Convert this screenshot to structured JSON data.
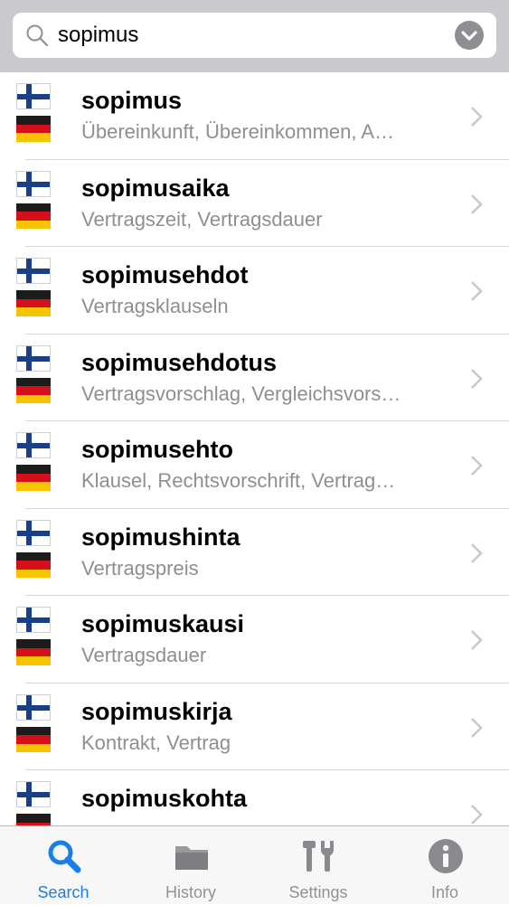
{
  "search": {
    "value": "sopimus",
    "placeholder": ""
  },
  "results": [
    {
      "term": "sopimus",
      "translation": "Übereinkunft, Übereinkommen, A…"
    },
    {
      "term": "sopimusaika",
      "translation": "Vertragszeit, Vertragsdauer"
    },
    {
      "term": "sopimusehdot",
      "translation": "Vertragsklauseln"
    },
    {
      "term": "sopimusehdotus",
      "translation": "Vertragsvorschlag, Vergleichsvors…"
    },
    {
      "term": "sopimusehto",
      "translation": "Klausel, Rechtsvorschrift, Vertrag…"
    },
    {
      "term": "sopimushinta",
      "translation": "Vertragspreis"
    },
    {
      "term": "sopimuskausi",
      "translation": "Vertragsdauer"
    },
    {
      "term": "sopimuskirja",
      "translation": "Kontrakt, Vertrag"
    },
    {
      "term": "sopimuskohta",
      "translation": ""
    }
  ],
  "tabs": [
    {
      "label": "Search",
      "icon": "search-icon",
      "active": true
    },
    {
      "label": "History",
      "icon": "folder-icon",
      "active": false
    },
    {
      "label": "Settings",
      "icon": "tools-icon",
      "active": false
    },
    {
      "label": "Info",
      "icon": "info-icon",
      "active": false
    }
  ],
  "colors": {
    "accent": "#1a7ee8",
    "inactive": "#929296",
    "secondary_text": "#8e8e93"
  }
}
